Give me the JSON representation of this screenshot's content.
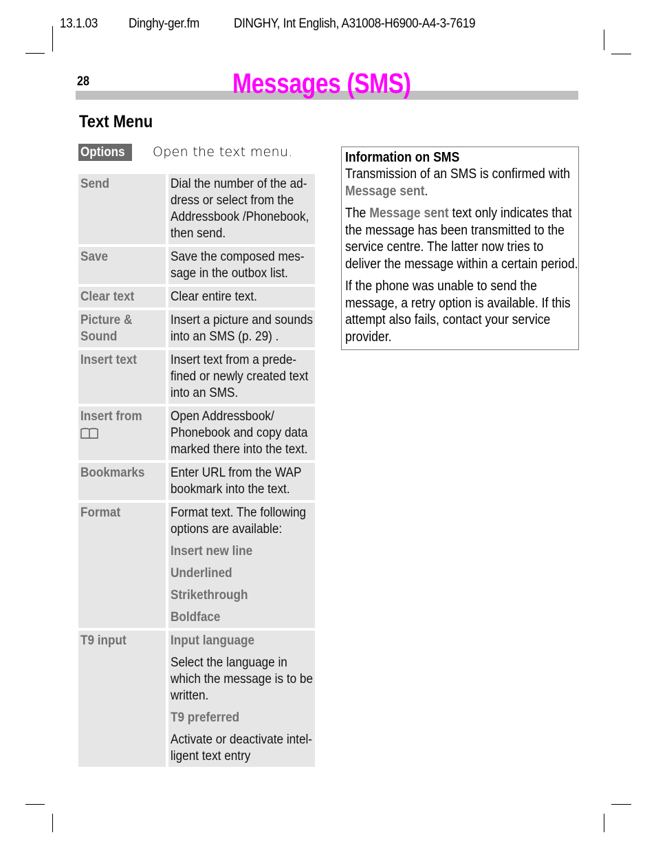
{
  "header": {
    "date": "13.1.03",
    "file": "Dinghy-ger.fm",
    "doc_id": "DINGHY, Int English, A31008-H6900-A4-3-7619"
  },
  "page": {
    "number": "28",
    "title": "Messages (SMS)",
    "title_color": "#ff00ff",
    "section_title": "Text Menu"
  },
  "options": {
    "button_label": "Options",
    "description": "Open the text menu."
  },
  "menu": [
    {
      "key": "Send",
      "desc": "Dial the number of the ad-dress or select from the Addressbook /Phonebook, then send."
    },
    {
      "key": "Save",
      "desc": "Save the composed mes-sage in the outbox list."
    },
    {
      "key": "Clear text",
      "desc": "Clear entire text."
    },
    {
      "key": "Picture & Sound",
      "desc": "Insert a picture and sounds into an SMS (p. 29) ."
    },
    {
      "key": "Insert text",
      "desc": "Insert text from a prede-fined or newly created text into an SMS."
    },
    {
      "key": "Insert from",
      "icon": "phonebook-icon",
      "desc": "Open Addressbook/ Phonebook and copy data marked there into the text."
    },
    {
      "key": "Bookmarks",
      "desc": "Enter URL from the WAP bookmark into the text."
    },
    {
      "key": "Format",
      "desc": "Format text. The following options are available:",
      "sub": [
        "Insert new line",
        "Underlined",
        "Strikethrough",
        "Boldface"
      ]
    },
    {
      "key": "T9 input",
      "sub_items": [
        {
          "label": "Input language",
          "desc": "Select the language in which the message is to be written."
        },
        {
          "label": "T9 preferred",
          "desc": "Activate or deactivate intel-ligent text entry"
        }
      ]
    }
  ],
  "info_box": {
    "title": "Information on SMS",
    "p1_pre": "Transmission of an SMS is confirmed with ",
    "p1_em": "Message sent",
    "p1_post": ".",
    "p2_pre": "The ",
    "p2_em": "Message sent",
    "p2_post": " text only indicates that the message has been transmitted to the service centre. The latter now tries to deliver the message within a certain period.",
    "p3": "If the phone was unable to send the message, a retry option is available. If this attempt also fails, contact your service provider."
  }
}
